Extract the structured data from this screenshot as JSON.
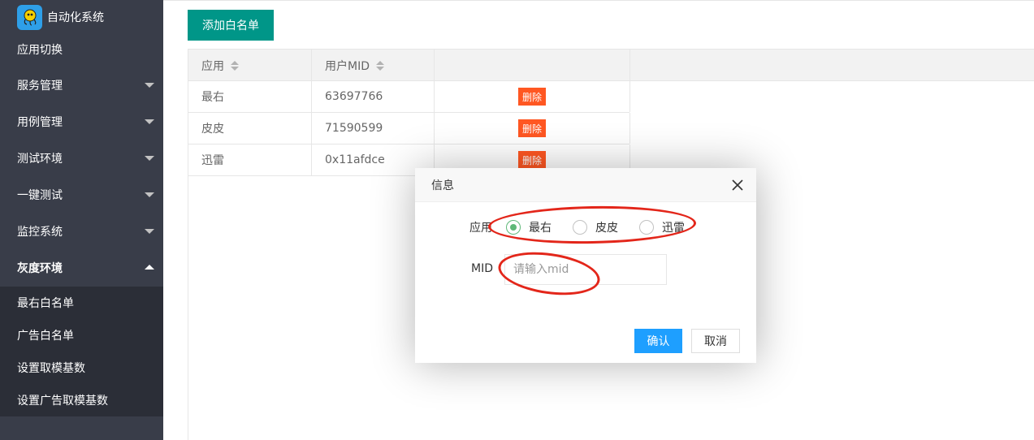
{
  "app": {
    "title": "自动化系统",
    "logo_icon": "octopus-logo-icon",
    "logo_color": "#2E9FE8"
  },
  "sidebar": {
    "items": [
      {
        "label": "应用切换",
        "has_caret": false
      },
      {
        "label": "服务管理",
        "has_caret": true
      },
      {
        "label": "用例管理",
        "has_caret": true
      },
      {
        "label": "测试环境",
        "has_caret": true
      },
      {
        "label": "一键测试",
        "has_caret": true
      },
      {
        "label": "监控系统",
        "has_caret": true
      },
      {
        "label": "灰度环境",
        "has_caret": true,
        "expanded": true
      }
    ],
    "subitems": [
      {
        "label": "最右白名单"
      },
      {
        "label": "广告白名单"
      },
      {
        "label": "设置取模基数"
      },
      {
        "label": "设置广告取模基数"
      }
    ]
  },
  "toolbar": {
    "add_label": "添加白名单",
    "add_color": "#009688"
  },
  "table": {
    "columns": [
      {
        "label": "应用",
        "sortable": true
      },
      {
        "label": "用户MID",
        "sortable": true
      },
      {
        "label": "",
        "sortable": false
      }
    ],
    "rows": [
      {
        "app": "最右",
        "mid": "63697766",
        "action": "删除"
      },
      {
        "app": "皮皮",
        "mid": "71590599",
        "action": "删除"
      },
      {
        "app": "迅雷",
        "mid": "0x11afdce",
        "action": "删除"
      }
    ],
    "delete_color": "#FF5722"
  },
  "dialog": {
    "title": "信息",
    "app_label": "应用",
    "options": [
      {
        "label": "最右",
        "checked": true
      },
      {
        "label": "皮皮",
        "checked": false
      },
      {
        "label": "迅雷",
        "checked": false
      }
    ],
    "mid_label": "MID",
    "mid_placeholder": "请输入mid",
    "mid_value": "",
    "confirm_label": "确认",
    "cancel_label": "取消",
    "confirm_color": "#1E9FFF",
    "radio_checked_color": "#5FB878"
  },
  "annotation_color": "#E3261A"
}
